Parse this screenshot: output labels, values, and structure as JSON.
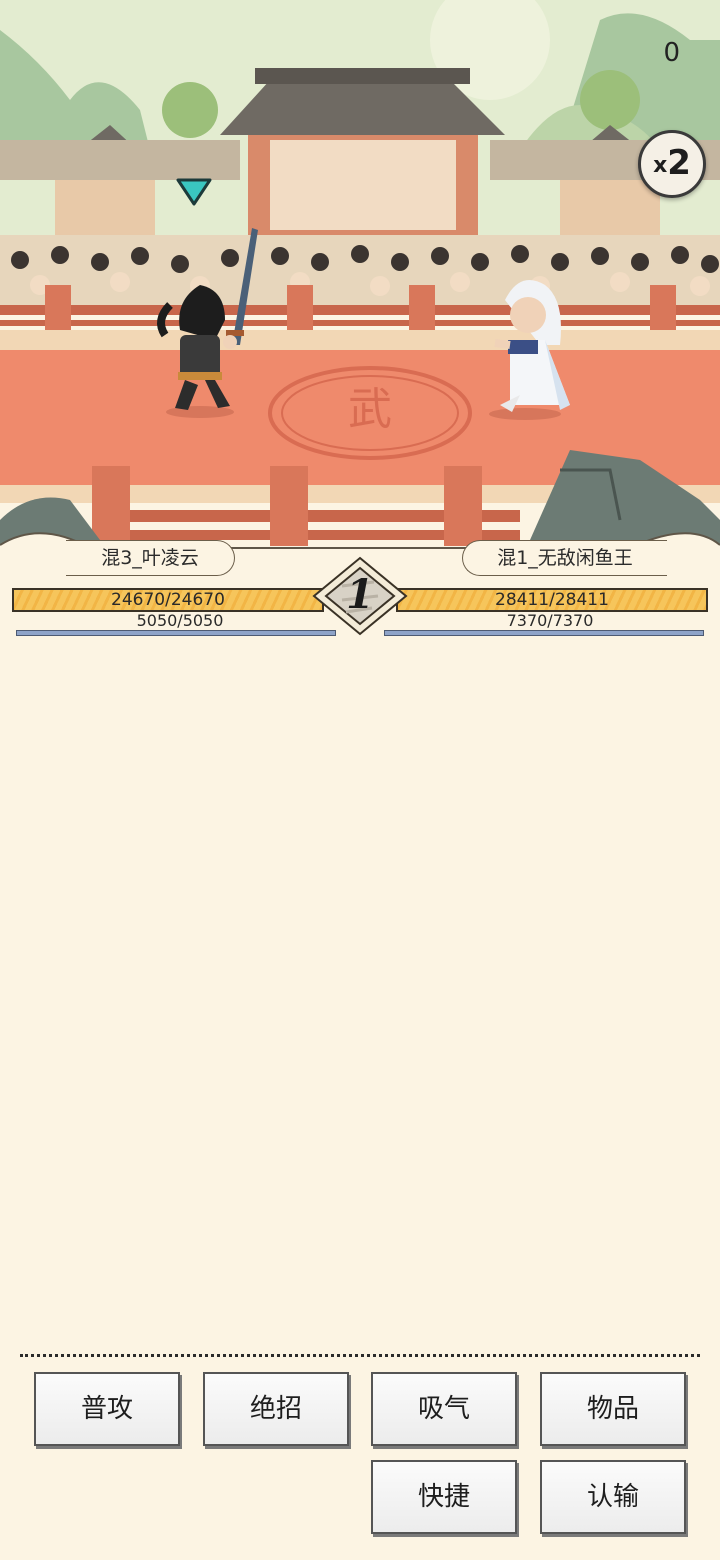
{
  "hud": {
    "score": "0",
    "speed": "2",
    "speed_prefix": "x"
  },
  "battle": {
    "round": "1",
    "player": {
      "name": "混3_叶凌云",
      "hp": "24670/24670",
      "mp": "5050/5050",
      "hp_fraction": 1.0,
      "mp_fraction": 1.0
    },
    "enemy": {
      "name": "混1_无敌闲鱼王",
      "hp": "28411/28411",
      "mp": "7370/7370",
      "hp_fraction": 1.0,
      "mp_fraction": 1.0
    },
    "arena_emblem": "武"
  },
  "actions": {
    "attack": "普攻",
    "ultimate": "绝招",
    "breathe": "吸气",
    "items": "物品",
    "shortcut": "快捷",
    "surrender": "认输"
  },
  "colors": {
    "sky": "#dfe9c9",
    "arena_floor": "#ef8a6c",
    "hp_fill": "#f6c55b",
    "mp_fill": "#8ea3c8",
    "background": "#fcf4e3",
    "marker": "#3ac6c0"
  },
  "icons": {
    "turn_marker": "turn-marker-icon",
    "speed_toggle": "speed-x2-icon"
  }
}
